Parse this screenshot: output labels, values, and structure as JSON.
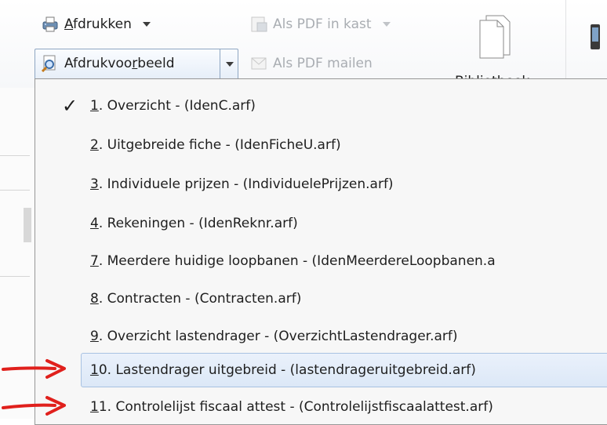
{
  "ribbon": {
    "print_label": "Afdrukken",
    "print_preview_label": "Afdrukvoorbeeld",
    "pdf_in_kast_label": "Als PDF in kast",
    "pdf_mail_label": "Als PDF mailen",
    "library_label": "Bibliotheek"
  },
  "menu": {
    "items": [
      {
        "key": "1",
        "text": ". Overzicht  -  (IdenC.arf)",
        "checked": true
      },
      {
        "key": "2",
        "text": ". Uitgebreide fiche  -  (IdenFicheU.arf)"
      },
      {
        "key": "3",
        "text": ". Individuele prijzen  -  (IndividuelePrijzen.arf)"
      },
      {
        "key": "4",
        "text": ". Rekeningen  -  (IdenReknr.arf)"
      },
      {
        "key": "7",
        "text": ". Meerdere huidige loopbanen  -  (IdenMeerdereLoopbanen.a"
      },
      {
        "key": "8",
        "text": ". Contracten  -  (Contracten.arf)"
      },
      {
        "key": "9",
        "text": ". Overzicht lastendrager  -  (OverzichtLastendrager.arf)"
      },
      {
        "key": "1",
        "text": "0. Lastendrager uitgebreid  -  (lastendrageruitgebreid.arf)",
        "highlighted": true
      },
      {
        "key": "1",
        "text": "1. Controlelijst fiscaal attest  -  (Controlelijstfiscaalattest.arf)"
      }
    ]
  },
  "colors": {
    "highlight": "#dce8f7",
    "annotation_arrow": "#e0201c"
  }
}
